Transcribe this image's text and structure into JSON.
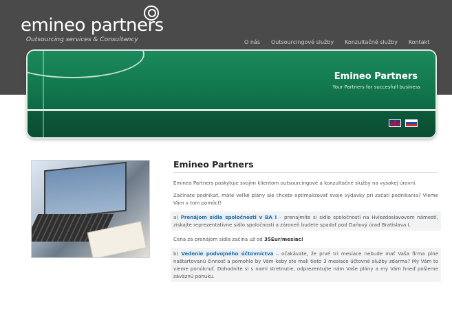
{
  "header": {
    "logo": "emineo partners",
    "tagline": "Outsourcing services & Consultancy",
    "nav": [
      "O nás",
      "Outsourcingové služby",
      "Konzultačné služby",
      "Kontakt"
    ]
  },
  "banner": {
    "title": "Emineo Partners",
    "subtitle": "Your Partners for succesfull business",
    "languages": [
      "en-flag-icon",
      "sk-flag-icon"
    ]
  },
  "main": {
    "heading": "Emineo Partners",
    "intro": "Emineo Partners poskytuje svojim klientom outsourcingové a konzultačné služby na vysokej úrovni.",
    "para2": "Začínate podnikať, máte veľké plány ale chcete optimalizovať svoje výdavky pri začatí podnikania? Vieme Vám v tom pomôcť!",
    "item_a_prefix": "a)",
    "item_a_link": "Prenájom sídla spoločnosti v BA I",
    "item_a_text": " – prenajmite si sídlo spoločnosti na Hviezdoslavovom námestí, získajte reprezentatívne sídlo spoločnosti a zároveň budete spadať pod Daňový úrad Bratislava I.",
    "price_text": "Cena za prenájom sídla začína už od ",
    "price_value": "35Eur/mesiac!",
    "item_b_prefix": "b)",
    "item_b_link": "Vedenie podvojného účtovníctva",
    "item_b_text": " – očakávate, že prvé tri mesiace nebude mať Vaša firma plne naštartovanú činnosť a pomohlo by Vám keby ste mali tieto 3 mesiace účtovné služby zdarma? My Vám to vieme ponúknuť. Dohodnite si s nami stretnutie, odprezentujte nám Vaše plány a my Vám hneď pošleme záväznú ponuku."
  }
}
